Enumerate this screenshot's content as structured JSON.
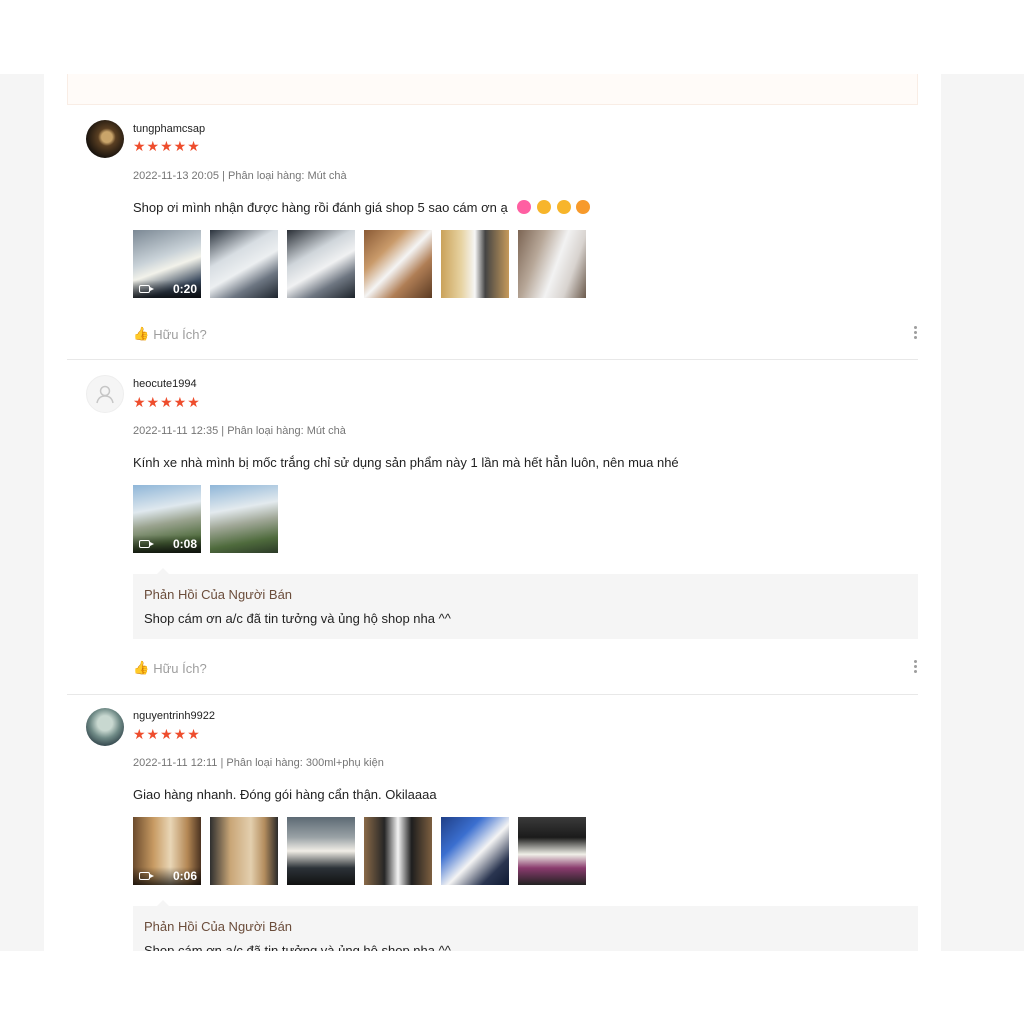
{
  "reviews": [
    {
      "author": "tungphamcsap",
      "stars": "★★★★★",
      "meta": "2022-11-13 20:05 | Phân loại hàng: Mút chà",
      "content": "Shop ơi mình nhận được hàng rồi đánh giá shop 5 sao cám ơn ạ",
      "emojis": [
        "heart-icon",
        "heart-eyes-icon",
        "heart-eyes-icon",
        "smiling-hearts-icon"
      ],
      "video_duration": "0:20",
      "helpful_label": "Hữu Ích?"
    },
    {
      "author": "heocute1994",
      "stars": "★★★★★",
      "meta": "2022-11-11 12:35 | Phân loại hàng: Mút chà",
      "content": "Kính xe nhà mình bị mốc trắng  chỉ sử dụng sản phẩm này 1 lần mà hết hẳn luôn, nên mua nhé",
      "video_duration": "0:08",
      "reply_title": "Phản Hồi Của Người Bán",
      "reply_text": "Shop cám ơn a/c đã tin tưởng và ủng hộ shop nha ^^",
      "helpful_label": "Hữu Ích?"
    },
    {
      "author": "nguyentrinh9922",
      "stars": "★★★★★",
      "meta": "2022-11-11 12:11 | Phân loại hàng: 300ml+phụ kiện",
      "content": "Giao hàng nhanh. Đóng gói hàng cẩn thận. Okilaaaa",
      "video_duration": "0:06",
      "reply_title": "Phản Hồi Của Người Bán",
      "reply_text": "Shop cám ơn a/c đã tin tưởng và ủng hộ shop nha ^^"
    }
  ],
  "colors": {
    "star": "#ee4d2d",
    "reply_title": "#6b4d3b",
    "meta": "#757575"
  }
}
